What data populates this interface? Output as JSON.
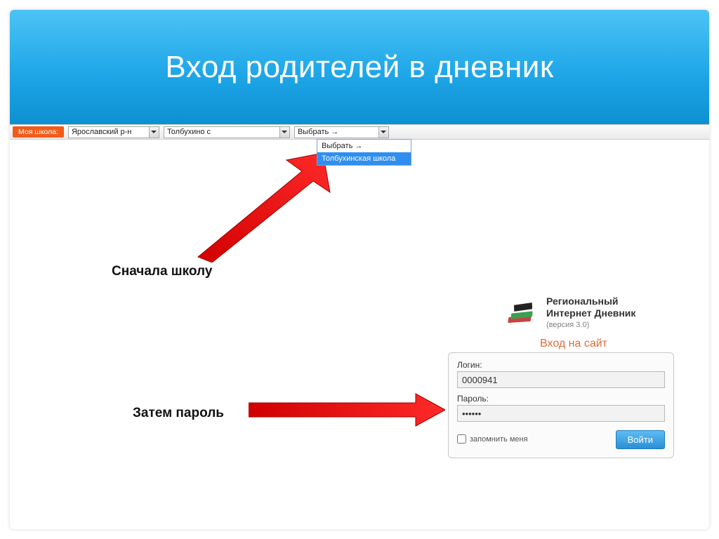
{
  "header": {
    "title": "Вход родителей в дневник"
  },
  "toolbar": {
    "tag": "Моя школа:",
    "region": "Ярославский р-н",
    "locality": "Толбухино с",
    "school_placeholder": "Выбрать →"
  },
  "dropdown": {
    "opt_placeholder": "Выбрать →",
    "opt_selected": "Толбухинская школа"
  },
  "captions": {
    "first": "Сначала школу",
    "second": "Затем пароль"
  },
  "product": {
    "line1": "Региональный",
    "line2": "Интернет Дневник",
    "version": "(версия 3.0)"
  },
  "login": {
    "title": "Вход на сайт",
    "login_label": "Логин:",
    "login_value": "0000941",
    "password_label": "Пароль:",
    "password_value": "••••••",
    "remember": "запомнить меня",
    "submit": "Войти"
  }
}
